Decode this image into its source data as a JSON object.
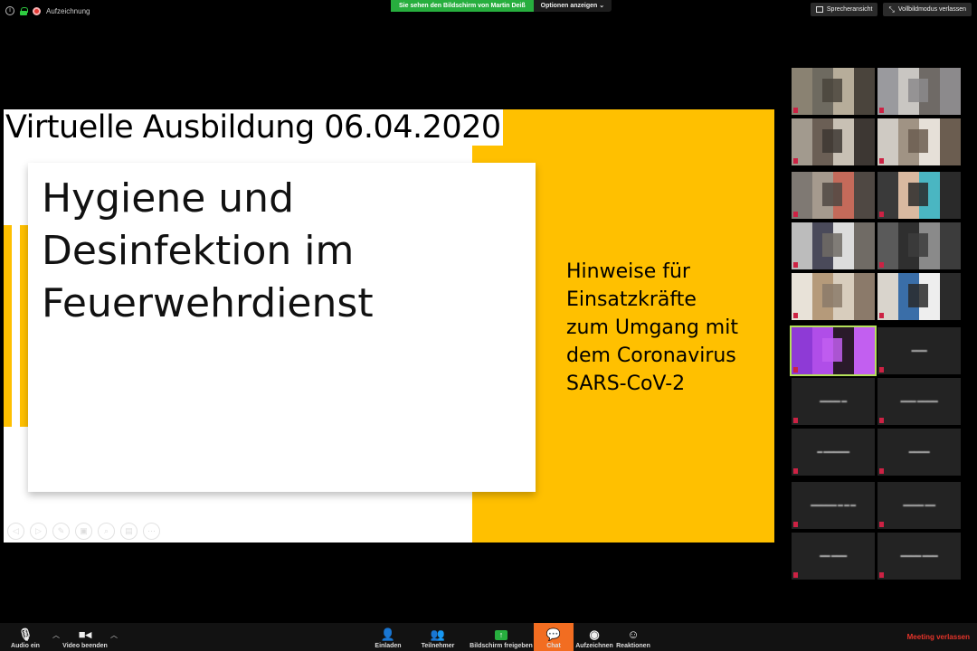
{
  "topbar": {
    "recording_label": "Aufzeichnung",
    "share_banner": "Sie sehen den Bildschirm von Martin Deiß",
    "options_button": "Optionen anzeigen ⌄",
    "speaker_view_button": "Sprecheransicht",
    "exit_fullscreen_button": "Vollbildmodus verlassen"
  },
  "slide": {
    "title": "Virtuelle Ausbildung 06.04.2020",
    "heading_lines": [
      "Hygiene und",
      "Desinfektion im",
      "Feuerwehrdienst"
    ],
    "subtitle_lines": [
      "Hinweise für",
      "Einsatzkräfte",
      "zum Umgang mit",
      "dem Coronavirus",
      "SARS-CoV-2"
    ],
    "accent_color": "#ffc000"
  },
  "gallery": {
    "tiles": [
      {
        "type": "video",
        "colors": [
          "#8a8272",
          "#6e6a60",
          "#b7ad9a",
          "#4a443c"
        ]
      },
      {
        "type": "video",
        "colors": [
          "#9a9a9e",
          "#c9c6c2",
          "#6f6a66",
          "#8c8a8c"
        ]
      },
      {
        "type": "video",
        "colors": [
          "#a29a8e",
          "#6b5f55",
          "#c8c0b4",
          "#3d3733"
        ]
      },
      {
        "type": "video",
        "colors": [
          "#cfcac3",
          "#a09384",
          "#e6e0d8",
          "#6b5d50"
        ]
      },
      {
        "type": "video",
        "colors": [
          "#7f7973",
          "#a59a8e",
          "#c46a5a",
          "#4f4843"
        ]
      },
      {
        "type": "video",
        "colors": [
          "#3a3a3a",
          "#d9b9a0",
          "#4ab6c2",
          "#2a2a2a"
        ]
      },
      {
        "type": "video",
        "colors": [
          "#bcbcbc",
          "#4a4a5a",
          "#dcdcdc",
          "#706b65"
        ]
      },
      {
        "type": "video",
        "colors": [
          "#5a5a5a",
          "#2f2f2f",
          "#8a8a8a",
          "#3c3c3c"
        ]
      },
      {
        "type": "video",
        "colors": [
          "#e8e2d8",
          "#b59a7a",
          "#d8cdbd",
          "#8b7a6a"
        ]
      },
      {
        "type": "video",
        "colors": [
          "#d9d4cc",
          "#3a6ea8",
          "#eeeeee",
          "#2a2a2a"
        ]
      },
      {
        "type": "video",
        "active": true,
        "colors": [
          "#8e3ad6",
          "#b04ee8",
          "#2a1a2a",
          "#c25ff0"
        ]
      },
      {
        "type": "name",
        "label": "▬▬▬"
      },
      {
        "type": "name",
        "label": "▬▬▬▬ ▬"
      },
      {
        "type": "name",
        "label": "▬▬▬ ▬▬▬▬"
      },
      {
        "type": "name",
        "label": "▬ ▬▬▬▬▬"
      },
      {
        "type": "name",
        "label": "▬▬▬▬"
      },
      {
        "type": "name",
        "label": "▬▬▬▬▬ ▬ ▬ ▬"
      },
      {
        "type": "name",
        "label": "▬▬▬▬ ▬▬"
      },
      {
        "type": "name",
        "label": "▬▬ ▬▬▬"
      },
      {
        "type": "name",
        "label": "▬▬▬▬ ▬▬▬"
      }
    ]
  },
  "toolbar": {
    "audio_label": "Audio ein",
    "video_label": "Video beenden",
    "invite_label": "Einladen",
    "participants_label": "Teilnehmer",
    "share_label": "Bildschirm freigeben",
    "chat_label": "Chat",
    "record_label": "Aufzeichnen",
    "reactions_label": "Reaktionen",
    "leave_label": "Meeting verlassen"
  }
}
